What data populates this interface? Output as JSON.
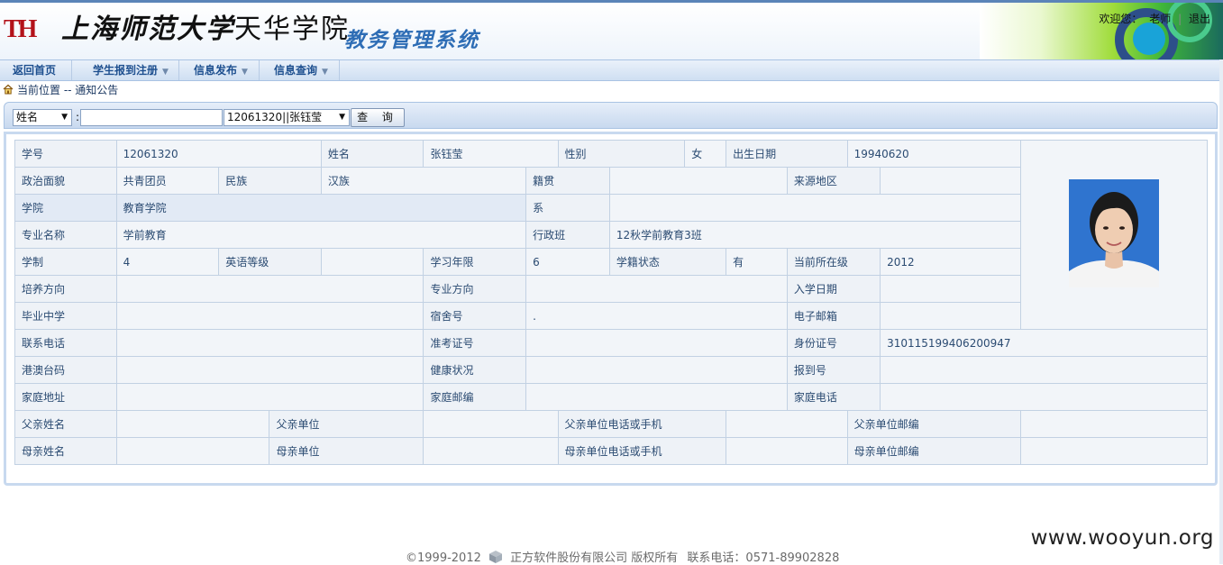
{
  "header": {
    "logo_mark": "TH",
    "school_name_script": "上海师范大学",
    "school_name_college": "天华学院",
    "system_title": "教务管理系统",
    "welcome": "欢迎您：",
    "user": "老师",
    "logout": "退出"
  },
  "menu": {
    "items": [
      {
        "label": "返回首页",
        "has_dropdown": false
      },
      {
        "label": "学生报到注册",
        "has_dropdown": true
      },
      {
        "label": "信息发布",
        "has_dropdown": true
      },
      {
        "label": "信息查询",
        "has_dropdown": true
      }
    ]
  },
  "breadcrumb": {
    "label": "当前位置 -- 通知公告",
    "icon": "home-icon"
  },
  "search": {
    "field_select": "姓名",
    "separator": ":",
    "text_value": "",
    "result_select": "12061320||张钰莹",
    "query_button": "查 询"
  },
  "student": {
    "labels": {
      "student_id": "学号",
      "name": "姓名",
      "gender": "性别",
      "birth_date": "出生日期",
      "political": "政治面貌",
      "ethnicity": "民族",
      "native_place": "籍贯",
      "origin_region": "来源地区",
      "college": "学院",
      "department": "系",
      "major": "专业名称",
      "admin_class": "行政班",
      "program_length": "学制",
      "english_level": "英语等级",
      "study_years": "学习年限",
      "enrollment_status": "学籍状态",
      "current_grade": "当前所在级",
      "training_direction": "培养方向",
      "major_direction": "专业方向",
      "entry_date": "入学日期",
      "high_school": "毕业中学",
      "dorm": "宿舍号",
      "email": "电子邮箱",
      "phone": "联系电话",
      "exam_ticket": "准考证号",
      "id_card": "身份证号",
      "hk_macau_tw": "港澳台码",
      "health": "健康状况",
      "report_no": "报到号",
      "home_address": "家庭地址",
      "home_postcode": "家庭邮编",
      "home_phone": "家庭电话",
      "father_name": "父亲姓名",
      "father_work": "父亲单位",
      "father_phone": "父亲单位电话或手机",
      "father_postcode": "父亲单位邮编",
      "mother_name": "母亲姓名",
      "mother_work": "母亲单位",
      "mother_phone": "母亲单位电话或手机",
      "mother_postcode": "母亲单位邮编"
    },
    "values": {
      "student_id": "12061320",
      "name": "张钰莹",
      "gender": "女",
      "birth_date": "19940620",
      "political": "共青团员",
      "ethnicity": "汉族",
      "native_place": "",
      "origin_region": "",
      "college": "教育学院",
      "department": "",
      "major": "学前教育",
      "admin_class": "12秋学前教育3班",
      "program_length": "4",
      "english_level": "",
      "study_years": "6",
      "enrollment_status": "有",
      "current_grade": "2012",
      "training_direction": "",
      "major_direction": "",
      "entry_date": "",
      "high_school": "",
      "dorm": ".",
      "email": "",
      "phone": "",
      "exam_ticket": "",
      "id_card": "310115199406200947",
      "hk_macau_tw": "",
      "health": "",
      "report_no": "",
      "home_address": "",
      "home_postcode": "",
      "home_phone": "",
      "father_name": "",
      "father_work": "",
      "father_phone": "",
      "father_postcode": "",
      "mother_name": "",
      "mother_work": "",
      "mother_phone": "",
      "mother_postcode": ""
    }
  },
  "footer": {
    "copyright": "©1999-2012",
    "company": "正方软件股份有限公司 版权所有",
    "contact": "联系电话：0571-89902828",
    "watermark": "www.wooyun.org"
  },
  "colors": {
    "brand_red": "#b3121a",
    "title_blue": "#2e6db5",
    "menu_text": "#1d4f8f",
    "table_border": "#c2d1e3"
  }
}
